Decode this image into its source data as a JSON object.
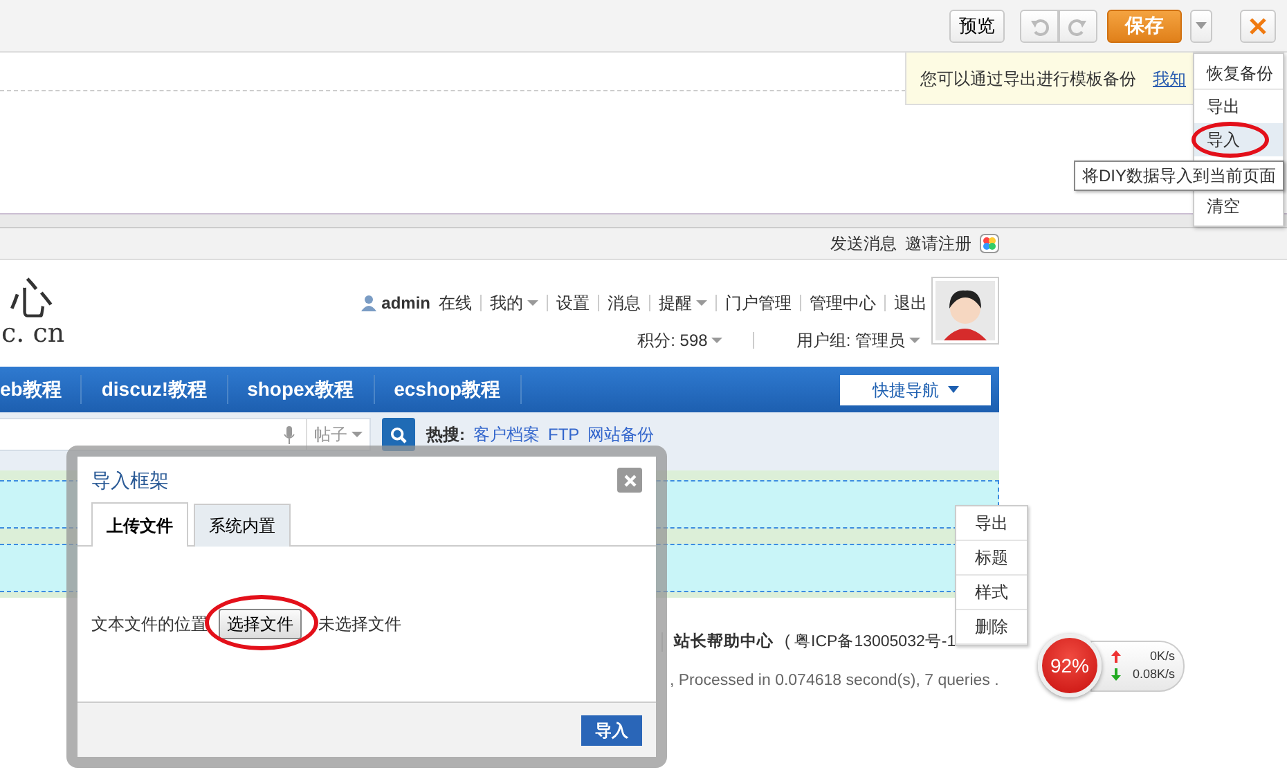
{
  "toolbar": {
    "preview": "预览",
    "save": "保存"
  },
  "notice": {
    "text": "您可以通过导出进行模板备份",
    "link": "我知"
  },
  "diy_menu": {
    "items": [
      {
        "label": "恢复备份",
        "selected": false,
        "divider_below": true,
        "circled": false
      },
      {
        "label": "导出",
        "selected": false,
        "divider_below": false,
        "circled": false
      },
      {
        "label": "导入",
        "selected": true,
        "divider_below": false,
        "circled": true
      },
      {
        "label": "清空",
        "selected": false,
        "divider_below": false,
        "circled": false
      }
    ],
    "tooltip": "将DIY数据导入到当前页面"
  },
  "topbar": {
    "links": [
      "发送消息",
      "邀请注册"
    ]
  },
  "header": {
    "logo_char": "心",
    "logo_domain": "c. cn",
    "user": "admin",
    "status": "在线",
    "links": [
      {
        "label": "我的",
        "dropdown": true
      },
      {
        "label": "设置",
        "dropdown": false
      },
      {
        "label": "消息",
        "dropdown": false
      },
      {
        "label": "提醒",
        "dropdown": true
      },
      {
        "label": "门户管理",
        "dropdown": false
      },
      {
        "label": "管理中心",
        "dropdown": false
      },
      {
        "label": "退出",
        "dropdown": false
      }
    ],
    "stats": [
      {
        "label": "积分: 598",
        "dropdown": true
      },
      {
        "label": "用户组: 管理员",
        "dropdown": true
      }
    ]
  },
  "nav": {
    "items": [
      "eb教程",
      "discuz!教程",
      "shopex教程",
      "ecshop教程"
    ],
    "quick": "快捷导航"
  },
  "search": {
    "scope": "帖子",
    "hot_label": "热搜:",
    "hot": [
      "客户档案",
      "FTP",
      "网站备份"
    ]
  },
  "footer": {
    "help": "站长帮助中心",
    "icp": "( 粤ICP备13005032号-1",
    "processed": ", Processed in 0.074618 second(s), 7 queries ."
  },
  "dialog": {
    "title": "导入框架",
    "tabs": [
      {
        "label": "上传文件",
        "selected": true
      },
      {
        "label": "系统内置",
        "selected": false
      }
    ],
    "field_label": "文本文件的位置",
    "file_button": "选择文件",
    "file_button_circled": true,
    "file_status": "未选择文件",
    "submit": "导入"
  },
  "context_menu": [
    "导出",
    "标题",
    "样式",
    "删除"
  ],
  "speed": {
    "percent": "92%",
    "up": "0K/s",
    "down": "0.08K/s"
  }
}
